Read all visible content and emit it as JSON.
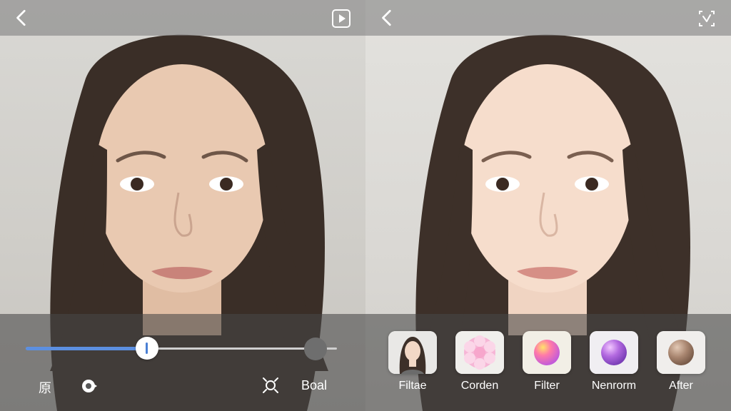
{
  "left_panel": {
    "slider": {
      "level_percent": 39
    },
    "labels": {
      "original": "原",
      "bokeh_label": "Boal"
    }
  },
  "right_panel": {
    "filters": [
      {
        "label": "Filtae"
      },
      {
        "label": "Corden"
      },
      {
        "label": "Filter"
      },
      {
        "label": "Nenrorm"
      },
      {
        "label": "After"
      }
    ]
  },
  "colors": {
    "accent": "#5c8fe0",
    "thumb_bar": "#4a7fd4"
  },
  "icons": {
    "back": "chevron-left-icon",
    "play": "play-square-icon",
    "compare": "compare-icon",
    "camera": "camera-icon",
    "focus": "focus-icon"
  }
}
